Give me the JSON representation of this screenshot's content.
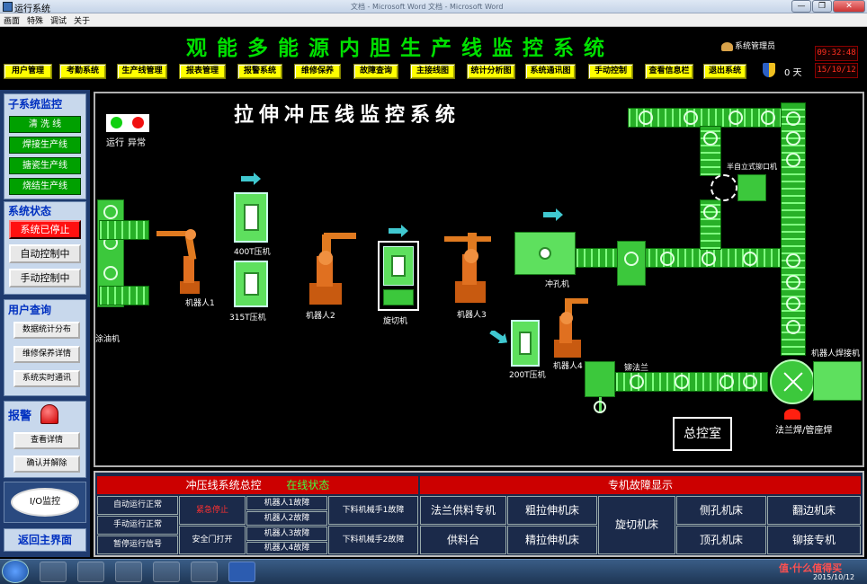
{
  "window": {
    "title": "运行系统",
    "faint_text": "文档 - Microsoft Word 文档 - Microsoft Word",
    "min": "—",
    "max": "❐",
    "close": "✕"
  },
  "menu": [
    "画面",
    "特殊",
    "调试",
    "关于"
  ],
  "header": {
    "title": "观能多能源内胆生产线监控系统",
    "admin_label": "系统管理员",
    "time": "09:32:48",
    "date": "15/10/12",
    "days": "0 天"
  },
  "nav": [
    "用户管理",
    "考勤系统",
    "生产线管理",
    "报表管理",
    "报警系统",
    "维修保养",
    "故障查询",
    "主接线图",
    "统计分析图",
    "系统通讯图",
    "手动控制",
    "查看信息栏",
    "退出系统"
  ],
  "left": {
    "subsystem_title": "子系统监控",
    "subsystems": [
      "清 洗 线",
      "焊接生产线",
      "搪瓷生产线",
      "烧结生产线"
    ],
    "status_title": "系统状态",
    "status_stopped": "系统已停止",
    "auto_ctrl": "自动控制中",
    "manual_ctrl": "手动控制中",
    "query_title": "用户查询",
    "queries": [
      "数据统计分布",
      "维修保养详情",
      "系统实时通讯"
    ],
    "alarm_title": "报警",
    "alarm_view": "查看详情",
    "alarm_ack": "确认并解除",
    "io_monitor": "I/O监控",
    "back_main": "返回主界面"
  },
  "canvas": {
    "title": "拉伸冲压线监控系统",
    "legend_run": "运行",
    "legend_fault": "异常",
    "labels": {
      "oiler": "涂油机",
      "robot1": "机器人1",
      "press400": "400T压机",
      "press315": "315T压机",
      "robot2": "机器人2",
      "spin_cut": "旋切机",
      "robot3": "机器人3",
      "punch": "冲孔机",
      "press200": "200T压机",
      "robot4": "机器人4",
      "rivet_flange": "铆法兰",
      "semi_auto": "半自立式铆口机",
      "robot_welder": "机器人焊接机",
      "flange_weld": "法兰焊/管座焊",
      "control_room": "总控室"
    }
  },
  "bottom": {
    "left_header": "冲压线系统总控",
    "online": "在线状态",
    "right_header": "专机故障显示",
    "modes": [
      "自动运行正常",
      "手动运行正常",
      "暂停运行信号"
    ],
    "emergency": "紧急停止",
    "safety_door": "安全门打开",
    "robot_faults": [
      "机器人1故障",
      "机器人2故障",
      "机器人3故障",
      "机器人4故障"
    ],
    "manip_faults": [
      "下料机械手1故障",
      "下料机械手2故障"
    ],
    "machines_row1": [
      "法兰供料专机",
      "粗拉伸机床"
    ],
    "machines_row2": [
      "供料台",
      "精拉伸机床"
    ],
    "spin_cut_machine": "旋切机床",
    "machines_right_row1": [
      "侧孔机床",
      "翻边机床"
    ],
    "machines_right_row2": [
      "顶孔机床",
      "铆接专机"
    ]
  },
  "taskbar": {
    "date": "2015/10/12",
    "watermark": "值·什么值得买"
  },
  "colors": {
    "accent_green": "#00e000",
    "nav_yellow": "#ffff00",
    "alarm_red": "#ff0000",
    "belt_green": "#3cc83c"
  }
}
